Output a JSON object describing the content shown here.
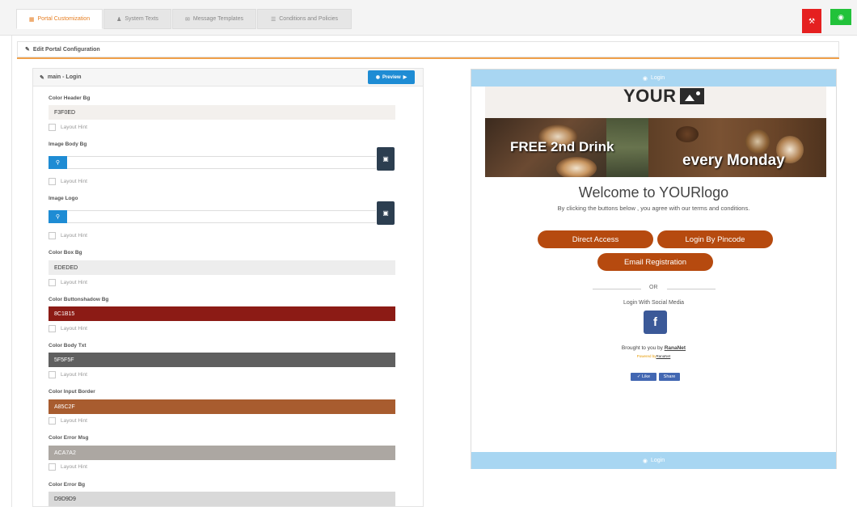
{
  "tabs": [
    {
      "label": "Portal Customization",
      "icon": "palette-icon"
    },
    {
      "label": "System Texts",
      "icon": "user-icon"
    },
    {
      "label": "Message Templates",
      "icon": "envelope-icon"
    },
    {
      "label": "Conditions and Policies",
      "icon": "list-icon"
    }
  ],
  "header": {
    "section_title": "Edit Portal Configuration"
  },
  "form": {
    "panel_title": "main - Login",
    "preview_label": "Preview",
    "hint_label": "Layout Hint",
    "fields": [
      {
        "label": "Color Header Bg",
        "value": "F3F0ED",
        "bg": "#f3f0ed",
        "fg": "#333333"
      },
      {
        "label": "Image Body Bg"
      },
      {
        "label": "Image Logo"
      },
      {
        "label": "Color Box Bg",
        "value": "EDEDED",
        "bg": "#ededed",
        "fg": "#333333"
      },
      {
        "label": "Color Buttonshadow Bg",
        "value": "8C1B15",
        "bg": "#8c1b15",
        "fg": "#ffffff"
      },
      {
        "label": "Color Body Txt",
        "value": "5F5F5F",
        "bg": "#5f5f5f",
        "fg": "#ffffff"
      },
      {
        "label": "Color Input Border",
        "value": "A85C2F",
        "bg": "#a85c2f",
        "fg": "#ffffff"
      },
      {
        "label": "Color Error Msg",
        "value": "ACA7A2",
        "bg": "#aca7a2",
        "fg": "#ffffff"
      },
      {
        "label": "Color Error Bg",
        "value": "D9D9D9",
        "bg": "#d9d9d9",
        "fg": "#333333"
      }
    ]
  },
  "preview": {
    "band_label": "Login",
    "logo_text": "YOUR",
    "banner_text_1": "FREE 2nd Drink",
    "banner_text_2": "every Monday",
    "welcome": "Welcome to YOURlogo",
    "agree_text": "By clicking the buttons below , you agree with our terms and conditions.",
    "btn_direct": "Direct Access",
    "btn_pincode": "Login By Pincode",
    "btn_email": "Email Registration",
    "or_text": "OR",
    "social_label": "Login With Social Media",
    "fb_letter": "f",
    "brought_prefix": "Brought to you by",
    "brought_name": "RanaNet",
    "powered_prefix": "Powered by",
    "powered_name": "RanaNet",
    "like_label": "Like",
    "share_label": "Share",
    "button_color": "#b64a0f"
  }
}
